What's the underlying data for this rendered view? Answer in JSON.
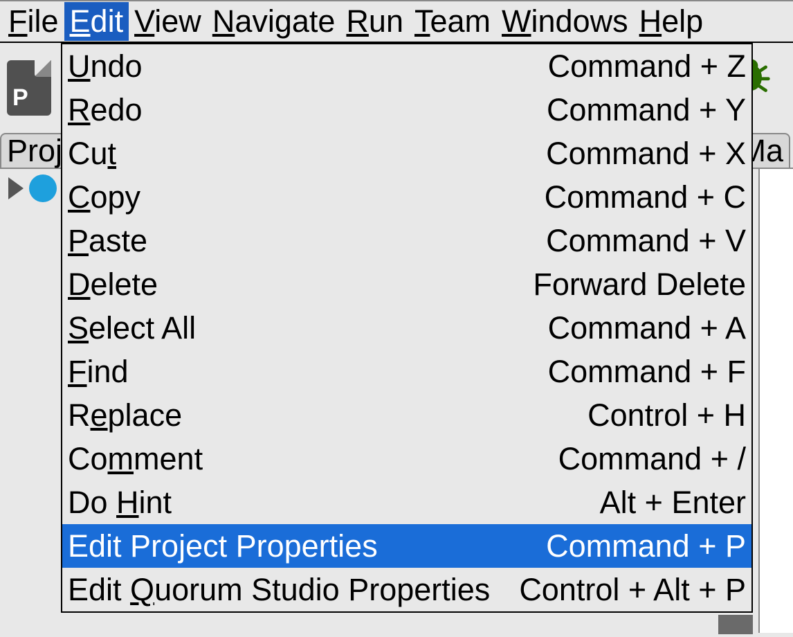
{
  "menubar": {
    "items": [
      {
        "pre": "",
        "u": "F",
        "post": "ile"
      },
      {
        "pre": "",
        "u": "E",
        "post": "dit"
      },
      {
        "pre": "",
        "u": "V",
        "post": "iew"
      },
      {
        "pre": "",
        "u": "N",
        "post": "avigate"
      },
      {
        "pre": "",
        "u": "R",
        "post": "un"
      },
      {
        "pre": "",
        "u": "T",
        "post": "eam"
      },
      {
        "pre": "",
        "u": "W",
        "post": "indows"
      },
      {
        "pre": "",
        "u": "H",
        "post": "elp"
      }
    ],
    "activeIndex": 1
  },
  "tabs": {
    "left": "Proj",
    "right": "Ma"
  },
  "toolbar": {
    "fileLetter": "P"
  },
  "dropdown": {
    "selectedIndex": 11,
    "items": [
      {
        "pre": "",
        "u": "U",
        "post": "ndo",
        "shortcut": "Command + Z"
      },
      {
        "pre": "",
        "u": "R",
        "post": "edo",
        "shortcut": "Command + Y"
      },
      {
        "pre": "Cu",
        "u": "t",
        "post": "",
        "shortcut": "Command + X"
      },
      {
        "pre": "",
        "u": "C",
        "post": "opy",
        "shortcut": "Command + C"
      },
      {
        "pre": "",
        "u": "P",
        "post": "aste",
        "shortcut": "Command + V"
      },
      {
        "pre": "",
        "u": "D",
        "post": "elete",
        "shortcut": "Forward Delete"
      },
      {
        "pre": "",
        "u": "S",
        "post": "elect All",
        "shortcut": "Command + A"
      },
      {
        "pre": "",
        "u": "F",
        "post": "ind",
        "shortcut": "Command + F"
      },
      {
        "pre": "R",
        "u": "e",
        "post": "place",
        "shortcut": "Control + H"
      },
      {
        "pre": "Co",
        "u": "m",
        "post": "ment",
        "shortcut": "Command + /"
      },
      {
        "pre": "Do ",
        "u": "H",
        "post": "int",
        "shortcut": "Alt + Enter"
      },
      {
        "pre": "Edit Project Properties",
        "u": "",
        "post": "",
        "shortcut": "Command + P"
      },
      {
        "pre": "Edit ",
        "u": "Q",
        "post": "uorum Studio Properties",
        "shortcut": "Control + Alt + P"
      }
    ]
  }
}
